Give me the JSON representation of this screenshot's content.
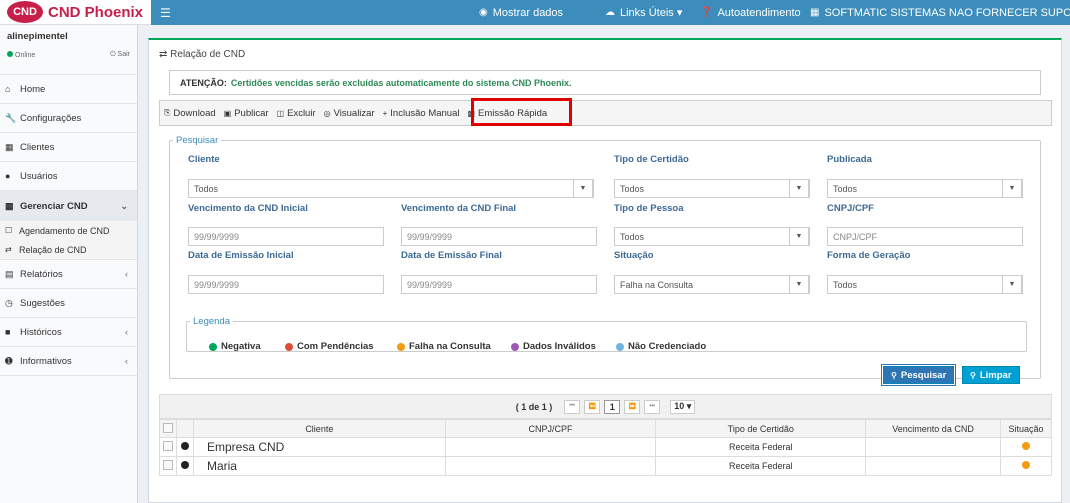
{
  "app": {
    "logo_mark": "CND",
    "logo_text": "CND Phoenix"
  },
  "topbar": {
    "items": [
      {
        "icon": "eye-icon",
        "label": "Mostrar dados"
      },
      {
        "icon": "cloud-icon",
        "label": "Links Úteis ▾"
      },
      {
        "icon": "question-icon",
        "label": "Autoatendimento"
      },
      {
        "icon": "building-icon",
        "label": "SOFTMATIC SISTEMAS NAO FORNECER SUPORTE ▾"
      }
    ]
  },
  "user": {
    "name": "alinepimentel",
    "status": "Online",
    "logout": "Sair"
  },
  "sidebar": {
    "items": [
      {
        "label": "Home",
        "icon": "home-icon"
      },
      {
        "label": "Configurações",
        "icon": "wrench-icon"
      },
      {
        "label": "Clientes",
        "icon": "building-icon"
      },
      {
        "label": "Usuários",
        "icon": "user-icon"
      },
      {
        "label": "Gerenciar CND",
        "icon": "calendar-icon"
      },
      {
        "label": "Relatórios",
        "icon": "file-icon"
      },
      {
        "label": "Sugestões",
        "icon": "comments-icon"
      },
      {
        "label": "Históricos",
        "icon": "book-icon"
      },
      {
        "label": "Informativos",
        "icon": "info-icon"
      }
    ],
    "subitems": [
      {
        "label": "Agendamento de CND"
      },
      {
        "label": "Relação de CND"
      }
    ]
  },
  "box": {
    "title": "Relação de CND"
  },
  "alert": {
    "label": "ATENÇÃO:",
    "message": "Certidões vencidas serão excluídas automaticamente do sistema CND Phoenix."
  },
  "toolbar": {
    "download": "Download",
    "publicar": "Publicar",
    "excluir": "Excluir",
    "visualizar": "Visualizar",
    "inclusao": "Inclusão Manual",
    "emissao": "Emissão Rápida"
  },
  "search": {
    "legend": "Pesquisar",
    "cliente_label": "Cliente",
    "cliente_value": "Todos",
    "tipo_certidao_label": "Tipo de Certidão",
    "tipo_certidao_value": "Todos",
    "publicada_label": "Publicada",
    "publicada_value": "Todos",
    "venc_inicial_label": "Vencimento da CND Inicial",
    "venc_inicial_placeholder": "99/99/9999",
    "venc_final_label": "Vencimento da CND Final",
    "venc_final_placeholder": "99/99/9999",
    "tipo_pessoa_label": "Tipo de Pessoa",
    "tipo_pessoa_value": "Todos",
    "cnpj_label": "CNPJ/CPF",
    "cnpj_placeholder": "CNPJ/CPF",
    "emissao_inicial_label": "Data de Emissão Inicial",
    "emissao_inicial_placeholder": "99/99/9999",
    "emissao_final_label": "Data de Emissão Final",
    "emissao_final_placeholder": "99/99/9999",
    "situacao_label": "Situação",
    "situacao_value": "Falha na Consulta",
    "forma_label": "Forma de Geração",
    "forma_value": "Todos",
    "pesquisar_btn": "Pesquisar",
    "limpar_btn": "Limpar"
  },
  "legenda": {
    "title": "Legenda",
    "items": [
      {
        "label": "Negativa",
        "color": "#00a65a"
      },
      {
        "label": "Com Pendências",
        "color": "#dd4b39"
      },
      {
        "label": "Falha na Consulta",
        "color": "#f39c12"
      },
      {
        "label": "Dados Inválidos",
        "color": "#9b59b6"
      },
      {
        "label": "Não Credenciado",
        "color": "#6fb3e0"
      }
    ]
  },
  "table": {
    "page_info": "( 1 de 1 )",
    "current_page": "1",
    "page_size": "10 ▾",
    "columns": [
      "Cliente",
      "CNPJ/CPF",
      "Tipo de Certidão",
      "Vencimento da CND",
      "Situação"
    ],
    "rows": [
      {
        "cliente": "Empresa CND",
        "cnpj": "",
        "tipo": "Receita Federal",
        "vencimento": "",
        "situacao_color": "#f39c12"
      },
      {
        "cliente": "Maria",
        "cnpj": "",
        "tipo": "Receita Federal",
        "vencimento": "",
        "situacao_color": "#f39c12"
      }
    ]
  }
}
